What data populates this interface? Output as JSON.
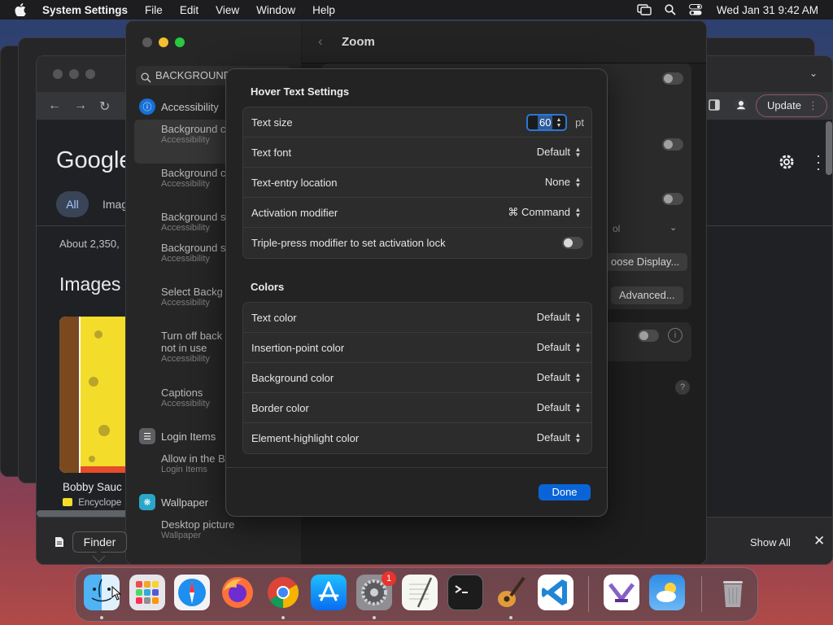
{
  "menubar": {
    "app": "System Settings",
    "menus": [
      "File",
      "Edit",
      "View",
      "Window",
      "Help"
    ],
    "clock": "Wed Jan 31  9:42 AM"
  },
  "chrome": {
    "update_label": "Update",
    "google": "Google",
    "tab_all": "All",
    "tab_images": "Imag",
    "about": "About 2,350,",
    "images_heading": "Images",
    "result_title": "Bobby Sauc",
    "result_source": "Encyclope",
    "show_all": "Show All"
  },
  "settings": {
    "search_value": "BACKGROUND",
    "title": "Zoom",
    "categories": {
      "accessibility": "Accessibility",
      "login_items": "Login Items",
      "wallpaper": "Wallpaper"
    },
    "results": [
      {
        "title": "Background c (Hover Text)",
        "sub": "Accessibility"
      },
      {
        "title": "Background c (Live Captio",
        "sub": "Accessibility"
      },
      {
        "title": "Background s",
        "sub": "Accessibility"
      },
      {
        "title": "Background sounds volun",
        "sub": "Accessibility"
      },
      {
        "title": "Select Backg Sound",
        "sub": "Accessibility"
      },
      {
        "title": "Turn off back sounds when not in use",
        "sub": "Accessibility"
      },
      {
        "title": "Captions",
        "sub": "Accessibility"
      },
      {
        "title": "Allow in the B",
        "sub": "Login Items"
      },
      {
        "title": "Desktop picture",
        "sub": "Wallpaper"
      }
    ],
    "choose_display": "oose Display...",
    "advanced": "Advanced...",
    "partial_text": "ol"
  },
  "sheet": {
    "title": "Hover Text Settings",
    "text_size_label": "Text size",
    "text_size_value": "60",
    "text_size_unit": "pt",
    "text_font_label": "Text font",
    "text_font_value": "Default",
    "entry_location_label": "Text-entry location",
    "entry_location_value": "None",
    "activation_label": "Activation modifier",
    "activation_value": "⌘ Command",
    "triple_press_label": "Triple-press modifier to set activation lock",
    "triple_press_on": false,
    "colors_title": "Colors",
    "colors": [
      {
        "label": "Text color",
        "value": "Default"
      },
      {
        "label": "Insertion-point color",
        "value": "Default"
      },
      {
        "label": "Background color",
        "value": "Default"
      },
      {
        "label": "Border color",
        "value": "Default"
      },
      {
        "label": "Element-highlight color",
        "value": "Default"
      }
    ],
    "done_label": "Done"
  },
  "tooltip": "Finder",
  "dock": {
    "apps": [
      "finder-icon",
      "launchpad-icon",
      "safari-icon",
      "firefox-icon",
      "chrome-icon",
      "app-store-icon",
      "system-settings-icon",
      "textedit-icon",
      "terminal-icon",
      "garageband-icon",
      "vscode-icon",
      "visual-studio-icon",
      "weather-icon",
      "trash-icon"
    ],
    "settings_badge": "1"
  },
  "colors": {
    "accent": "#0a64d8",
    "badge": "#e8332f"
  }
}
